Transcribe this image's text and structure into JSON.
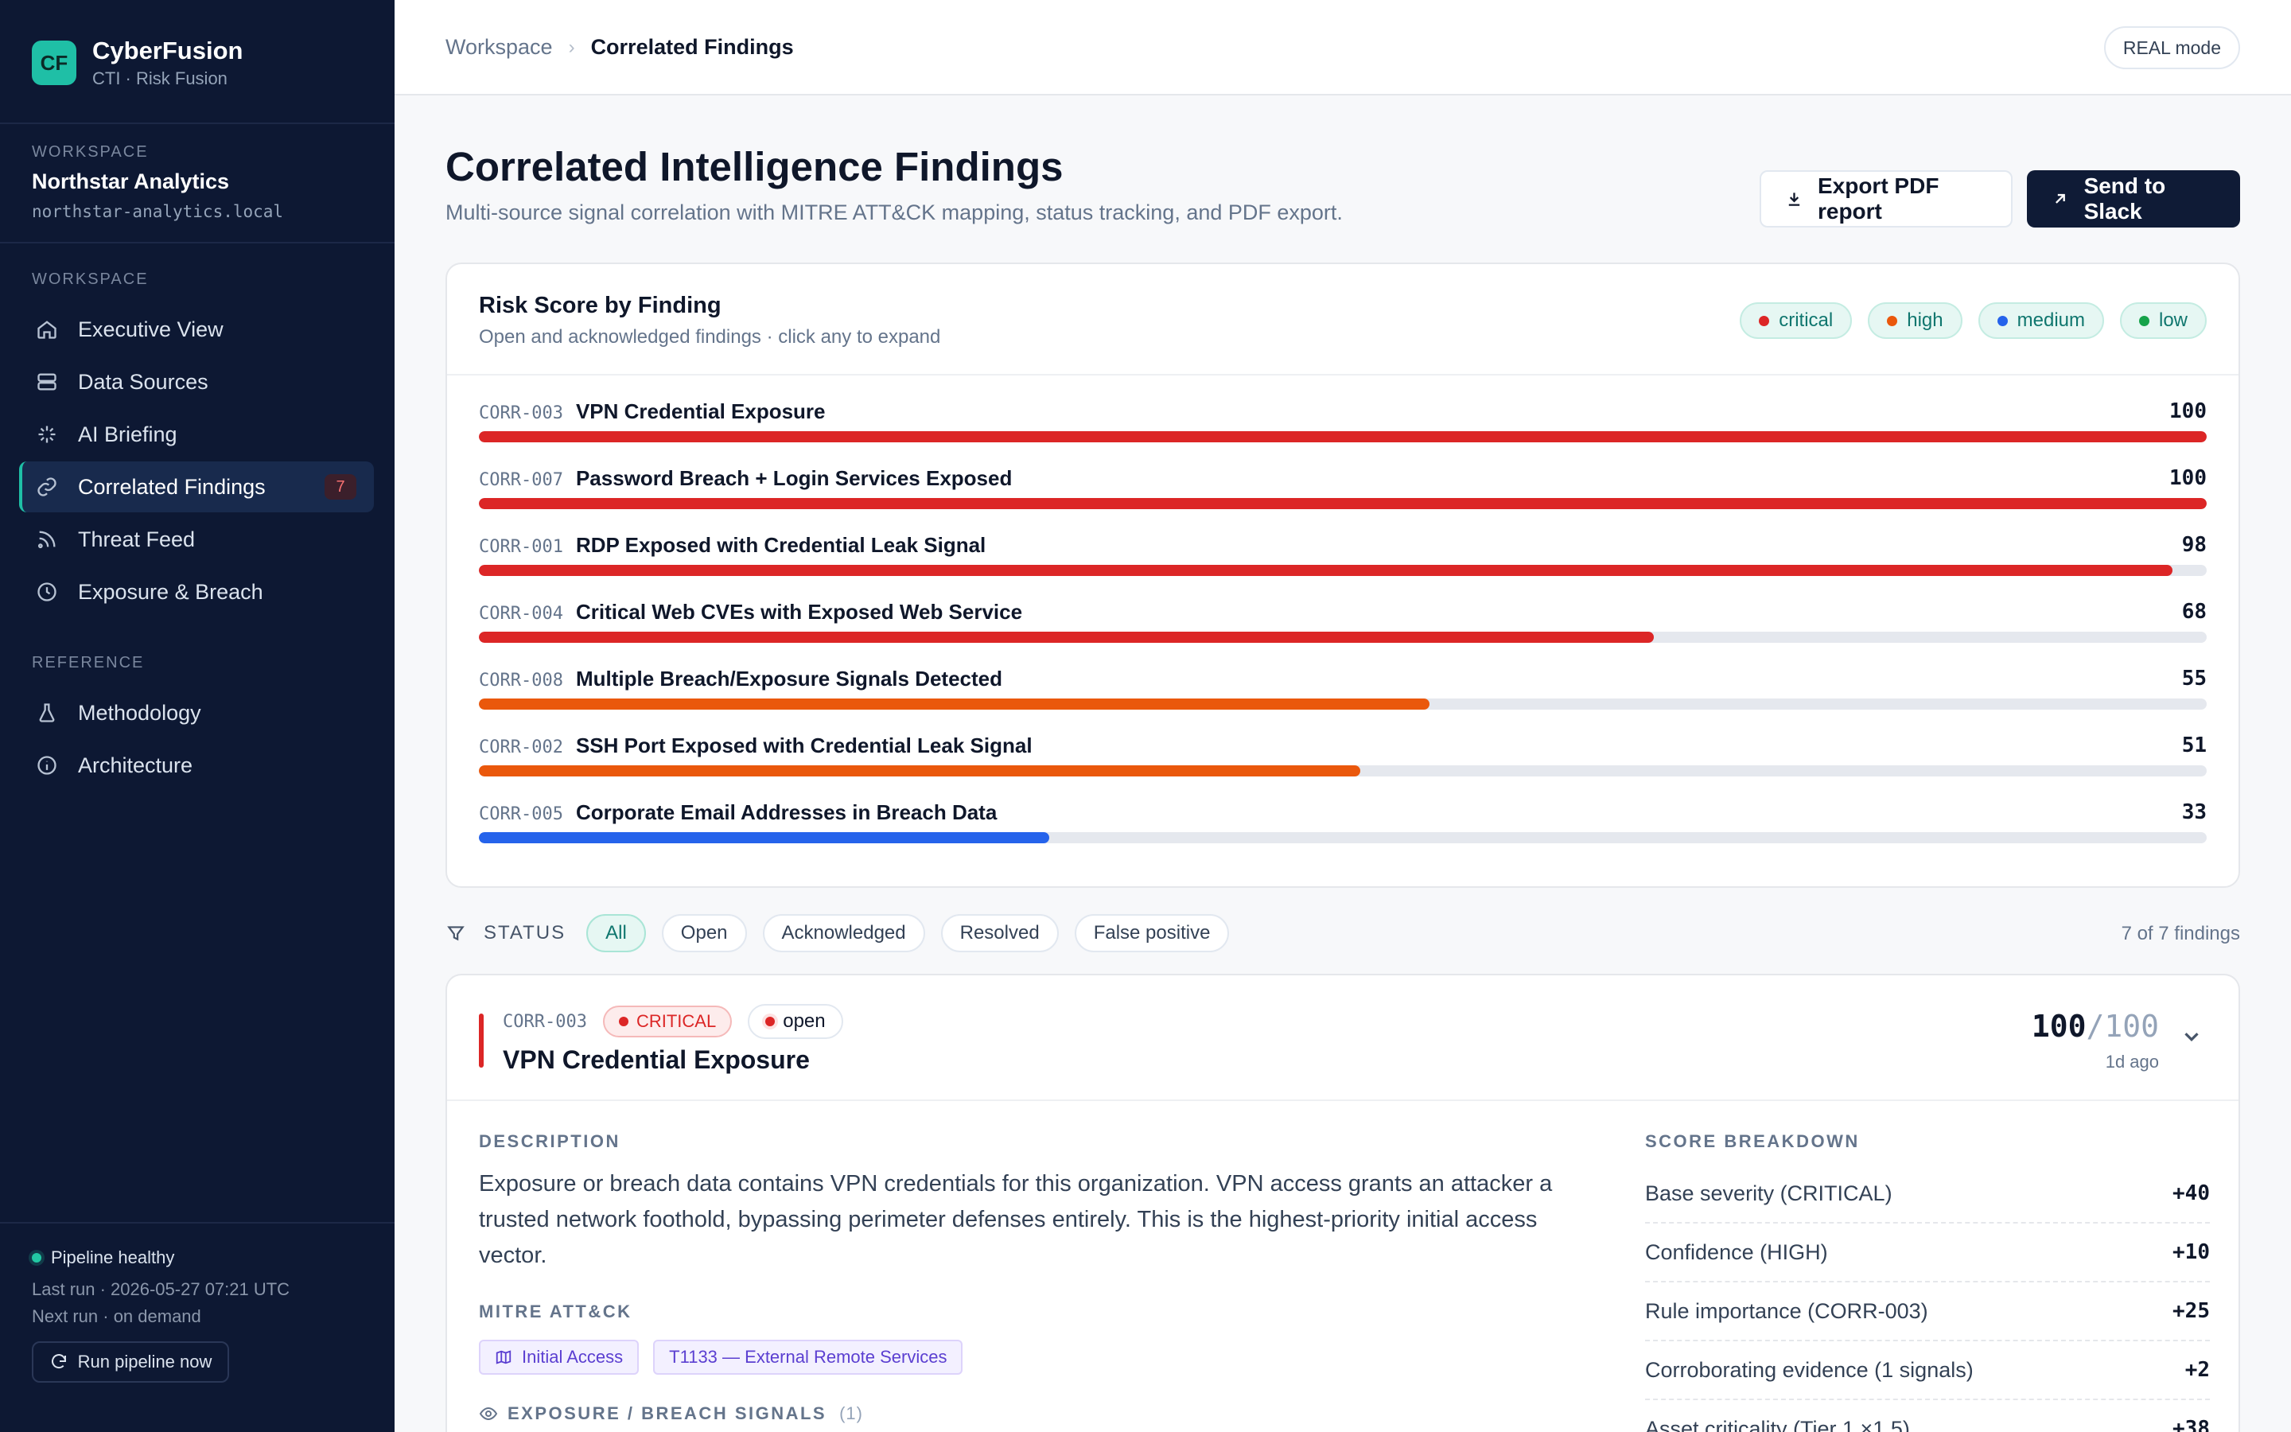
{
  "brand": {
    "logo": "CF",
    "name": "CyberFusion",
    "subtitle": "CTI · Risk Fusion"
  },
  "workspace": {
    "label": "WORKSPACE",
    "name": "Northstar Analytics",
    "host": "northstar-analytics.local"
  },
  "nav": {
    "section1": "WORKSPACE",
    "items": [
      {
        "label": "Executive View",
        "icon": "home-icon"
      },
      {
        "label": "Data Sources",
        "icon": "database-icon"
      },
      {
        "label": "AI Briefing",
        "icon": "sparkle-icon"
      },
      {
        "label": "Correlated Findings",
        "icon": "link-icon",
        "badge": "7"
      },
      {
        "label": "Threat Feed",
        "icon": "rss-icon"
      },
      {
        "label": "Exposure & Breach",
        "icon": "clock-icon"
      }
    ],
    "section2": "REFERENCE",
    "ref_items": [
      {
        "label": "Methodology",
        "icon": "flask-icon"
      },
      {
        "label": "Architecture",
        "icon": "info-icon"
      }
    ]
  },
  "pipeline": {
    "status": "Pipeline healthy",
    "last_run": "Last run · 2026-05-27 07:21 UTC",
    "next_run": "Next run · on demand",
    "run_button": "Run pipeline now"
  },
  "topbar": {
    "crumb_root": "Workspace",
    "crumb_current": "Correlated Findings",
    "mode": "REAL mode"
  },
  "page": {
    "title": "Correlated Intelligence Findings",
    "subtitle": "Multi-source signal correlation with MITRE ATT&CK mapping, status tracking, and PDF export.",
    "export_button": "Export PDF report",
    "slack_button": "Send to Slack"
  },
  "risk_card": {
    "title": "Risk Score by Finding",
    "subtitle": "Open and acknowledged findings · click any to expand",
    "legend": [
      {
        "label": "critical",
        "color": "#dc2626"
      },
      {
        "label": "high",
        "color": "#ea580c"
      },
      {
        "label": "medium",
        "color": "#2563eb"
      },
      {
        "label": "low",
        "color": "#16a34a"
      }
    ],
    "max_score": 100,
    "rows": [
      {
        "id": "CORR-003",
        "title": "VPN Credential Exposure",
        "score": 100,
        "severity": "critical"
      },
      {
        "id": "CORR-007",
        "title": "Password Breach + Login Services Exposed",
        "score": 100,
        "severity": "critical"
      },
      {
        "id": "CORR-001",
        "title": "RDP Exposed with Credential Leak Signal",
        "score": 98,
        "severity": "critical"
      },
      {
        "id": "CORR-004",
        "title": "Critical Web CVEs with Exposed Web Service",
        "score": 68,
        "severity": "critical"
      },
      {
        "id": "CORR-008",
        "title": "Multiple Breach/Exposure Signals Detected",
        "score": 55,
        "severity": "high"
      },
      {
        "id": "CORR-002",
        "title": "SSH Port Exposed with Credential Leak Signal",
        "score": 51,
        "severity": "high"
      },
      {
        "id": "CORR-005",
        "title": "Corporate Email Addresses in Breach Data",
        "score": 33,
        "severity": "medium"
      }
    ]
  },
  "filter": {
    "label": "STATUS",
    "chips": [
      "All",
      "Open",
      "Acknowledged",
      "Resolved",
      "False positive"
    ],
    "active": "All",
    "count": "7 of 7 findings"
  },
  "finding": {
    "id": "CORR-003",
    "severity": "CRITICAL",
    "status": "open",
    "title": "VPN Credential Exposure",
    "score": "100",
    "score_max": "/100",
    "ago": "1d ago",
    "description_label": "DESCRIPTION",
    "description": "Exposure or breach data contains VPN credentials for this organization. VPN access grants an attacker a trusted network foothold, bypassing perimeter defenses entirely. This is the highest-priority initial access vector.",
    "mitre_label": "MITRE ATT&CK",
    "tags": [
      "Initial Access",
      "T1133 — External Remote Services"
    ],
    "signals_label": "EXPOSURE / BREACH SIGNALS",
    "signals_count": "(1)",
    "breakdown_label": "SCORE BREAKDOWN",
    "breakdown": [
      {
        "label": "Base severity (CRITICAL)",
        "value": "+40"
      },
      {
        "label": "Confidence (HIGH)",
        "value": "+10"
      },
      {
        "label": "Rule importance (CORR-003)",
        "value": "+25"
      },
      {
        "label": "Corroborating evidence (1 signals)",
        "value": "+2"
      },
      {
        "label": "Asset criticality (Tier 1 ×1.5)",
        "value": "+38"
      }
    ]
  }
}
